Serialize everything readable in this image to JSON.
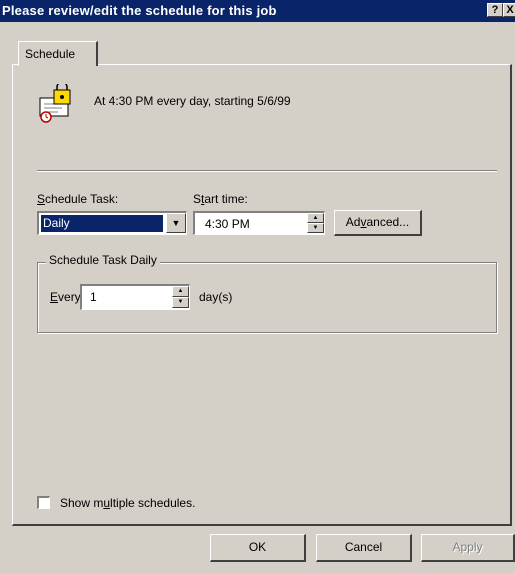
{
  "window": {
    "title": "Please review/edit the schedule for this job",
    "help_glyph": "?",
    "close_glyph": "X"
  },
  "tabs": [
    {
      "label": "Schedule"
    }
  ],
  "summary": {
    "icon": "scheduled-task-icon",
    "text": "At 4:30 PM every day, starting 5/6/99"
  },
  "schedule_task": {
    "label_first": "S",
    "label_rest": "chedule Task:",
    "value": "Daily"
  },
  "start_time": {
    "label_first": "S",
    "label_u": "t",
    "label_rest": "art time:",
    "value": "4:30 PM"
  },
  "advanced_button": {
    "label_pre": "Ad",
    "label_u": "v",
    "label_post": "anced..."
  },
  "daily_group": {
    "title": "Schedule Task Daily",
    "every_u": "E",
    "every_rest": "very",
    "every_value": "1",
    "unit": "day(s)"
  },
  "show_multiple": {
    "label_pre": "Show m",
    "label_u": "u",
    "label_post": "ltiple schedules.",
    "checked": false
  },
  "buttons": {
    "ok": "OK",
    "cancel": "Cancel",
    "apply": "Apply"
  },
  "colors": {
    "title_bar": "#0a246a",
    "face": "#d4d0c8"
  }
}
